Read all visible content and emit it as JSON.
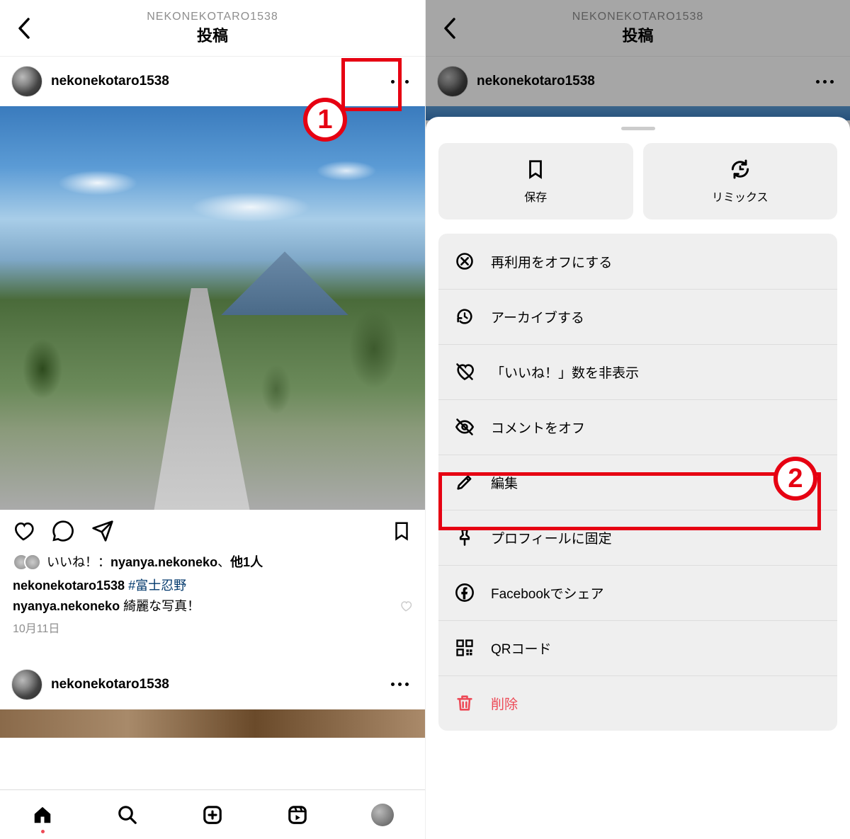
{
  "left": {
    "header": {
      "subtitle": "NEKONEKOTARO1538",
      "title": "投稿"
    },
    "post": {
      "author": "nekonekotaro1538",
      "likes_prefix": "いいね！：",
      "likes_user": "nyanya.nekoneko",
      "likes_suffix": "、",
      "likes_others": "他1人",
      "caption_user": "nekonekotaro1538",
      "caption_hashtag": "#富士忍野",
      "comment_user": "nyanya.nekoneko",
      "comment_text": " 綺麗な写真！",
      "date": "10月11日"
    },
    "post2": {
      "author": "nekonekotaro1538"
    },
    "annotations": {
      "n1": "1"
    }
  },
  "right": {
    "header": {
      "subtitle": "NEKONEKOTARO1538",
      "title": "投稿"
    },
    "author": "nekonekotaro1538",
    "sheet": {
      "cards": {
        "save": "保存",
        "remix": "リミックス"
      },
      "menu": {
        "reuse_off": "再利用をオフにする",
        "archive": "アーカイブする",
        "hide_likes": "「いいね！」数を非表示",
        "comments_off": "コメントをオフ",
        "edit": "編集",
        "pin": "プロフィールに固定",
        "fb_share": "Facebookでシェア",
        "qr": "QRコード",
        "delete": "削除"
      }
    },
    "annotations": {
      "n2": "2"
    }
  }
}
